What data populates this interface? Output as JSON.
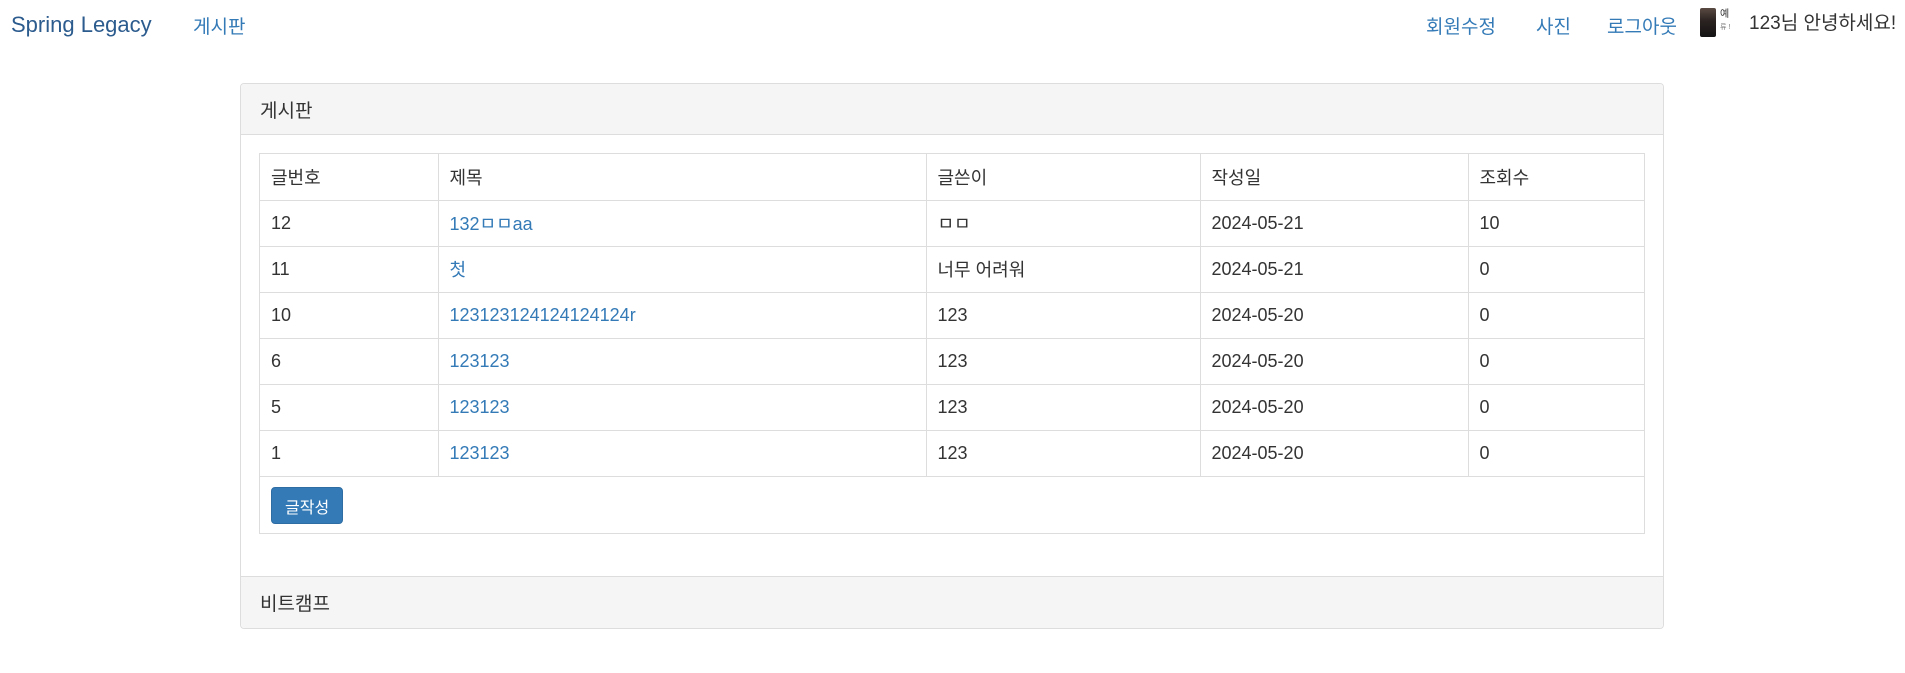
{
  "navbar": {
    "brand": "Spring Legacy",
    "board_link": "게시판",
    "right_links": {
      "edit_member": "회원수정",
      "photo": "사진",
      "logout": "로그아웃"
    },
    "avatar_caption": "예",
    "avatar_caption_sub": "류 !",
    "greeting": "123님 안녕하세요!"
  },
  "panel": {
    "heading": "게시판",
    "footer": "비트캠프",
    "table": {
      "headers": [
        "글번호",
        "제목",
        "글쓴이",
        "작성일",
        "조회수"
      ],
      "rows": [
        {
          "num": "12",
          "title": "132ㅁㅁaa",
          "writer": "ㅁㅁ",
          "date": "2024-05-21",
          "views": "10"
        },
        {
          "num": "11",
          "title": "첫",
          "writer": "너무 어려워",
          "date": "2024-05-21",
          "views": "0"
        },
        {
          "num": "10",
          "title": "123123124124124124r",
          "writer": "123",
          "date": "2024-05-20",
          "views": "0"
        },
        {
          "num": "6",
          "title": "123123",
          "writer": "123",
          "date": "2024-05-20",
          "views": "0"
        },
        {
          "num": "5",
          "title": "123123",
          "writer": "123",
          "date": "2024-05-20",
          "views": "0"
        },
        {
          "num": "1",
          "title": "123123",
          "writer": "123",
          "date": "2024-05-20",
          "views": "0"
        }
      ]
    },
    "write_button": "글작성"
  },
  "colors": {
    "link": "#337ab7",
    "brand": "#2c5b8e",
    "button": "#337ab7",
    "panel_header_bg": "#f5f5f5",
    "border": "#dddddd"
  }
}
